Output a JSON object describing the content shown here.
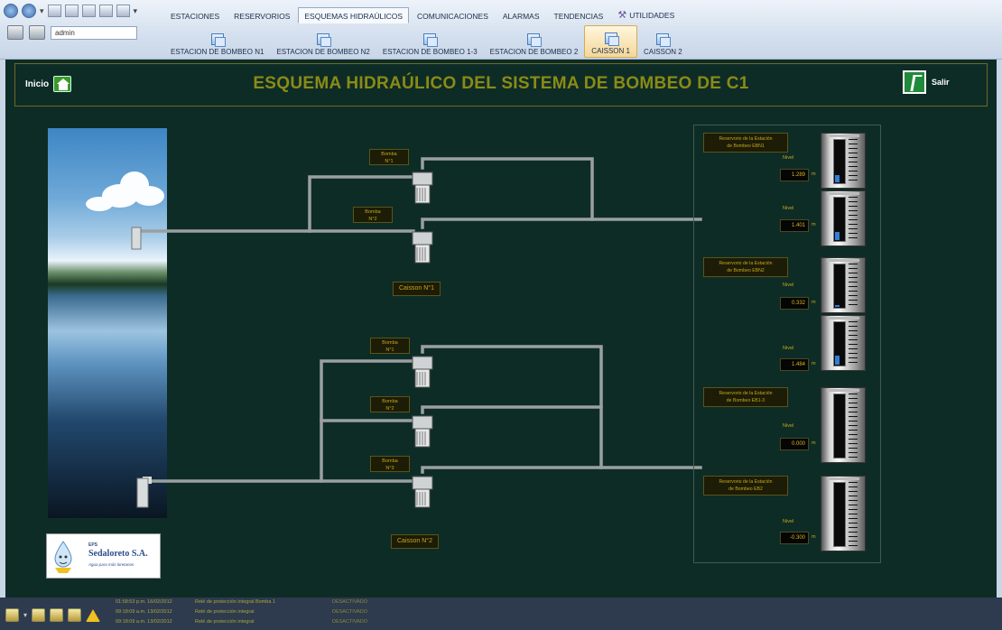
{
  "ribbon": {
    "user": "admin",
    "main_tabs": [
      {
        "label": "ESTACIONES",
        "active": false
      },
      {
        "label": "RESERVORIOS",
        "active": false
      },
      {
        "label": "ESQUEMAS HIDRAÚLICOS",
        "active": true
      },
      {
        "label": "COMUNICACIONES",
        "active": false
      },
      {
        "label": "ALARMAS",
        "active": false
      },
      {
        "label": "TENDENCIAS",
        "active": false
      },
      {
        "label": "UTILIDADES",
        "active": false
      }
    ],
    "sub_tabs": [
      {
        "label": "ESTACION DE BOMBEO N1",
        "active": false
      },
      {
        "label": "ESTACION DE BOMBEO N2",
        "active": false
      },
      {
        "label": "ESTACION DE BOMBEO 1-3",
        "active": false
      },
      {
        "label": "ESTACION DE BOMBEO 2",
        "active": false
      },
      {
        "label": "CAISSON 1",
        "active": true
      },
      {
        "label": "CAISSON 2",
        "active": false
      }
    ]
  },
  "header": {
    "home_label": "Inicio",
    "title": "ESQUEMA HIDRAÚLICO DEL SISTEMA DE BOMBEO DE C1",
    "exit_label": "Salir"
  },
  "pumps": [
    {
      "label": "Bomba\nN°1"
    },
    {
      "label": "Bomba\nN°2"
    },
    {
      "label": "Bomba\nN°1"
    },
    {
      "label": "Bomba\nN°2"
    },
    {
      "label": "Bomba\nN°3"
    }
  ],
  "caissons": [
    "Caisson N°1",
    "Caisson N°2"
  ],
  "reservoirs": [
    {
      "title": "Reservorio de la Estación\nde Bombeo EBN1",
      "readings": [
        {
          "label": "Nivel",
          "value": "1.289",
          "unit": "m",
          "fill": 0.18
        },
        {
          "label": "Nivel",
          "value": "1.401",
          "unit": "m",
          "fill": 0.2
        }
      ]
    },
    {
      "title": "Reservorio de la Estación\nde Bombeo EBN2",
      "readings": [
        {
          "label": "Nivel",
          "value": "0.332",
          "unit": "m",
          "fill": 0.05
        },
        {
          "label": "Nivel",
          "value": "1.484",
          "unit": "m",
          "fill": 0.22
        }
      ]
    },
    {
      "title": "Reservorio de la Estación\nde Bombeo EB1-3",
      "readings": [
        {
          "label": "Nivel",
          "value": "0.000",
          "unit": "m",
          "fill": 0
        }
      ]
    },
    {
      "title": "Reservorio de la Estación\nde Bombeo EB2",
      "readings": [
        {
          "label": "Nivel",
          "value": "-0.300",
          "unit": "m",
          "fill": 0
        }
      ]
    }
  ],
  "logo": {
    "eps": "EPS",
    "name": "Sedaloreto S.A.",
    "slogan": "Agua para más loretanos"
  },
  "alarms": [
    {
      "time": "01:58:53 p.m. 16/02/2012",
      "message": "Relé de protección integral Bomba 1",
      "state": "DESACTIVADO"
    },
    {
      "time": "09:18:09 a.m. 13/02/2012",
      "message": "Relé de protección integral",
      "state": "DESACTIVADO"
    },
    {
      "time": "09:18:09 a.m. 13/02/2012",
      "message": "Relé de protección integral",
      "state": "DESACTIVADO"
    }
  ],
  "colors": {
    "panel_bg": "#0e2c26",
    "title": "#8a8b16",
    "label_text": "#c8a81a",
    "pipe": "#9aa0a0",
    "tank_fill": "#2f7fd8"
  }
}
